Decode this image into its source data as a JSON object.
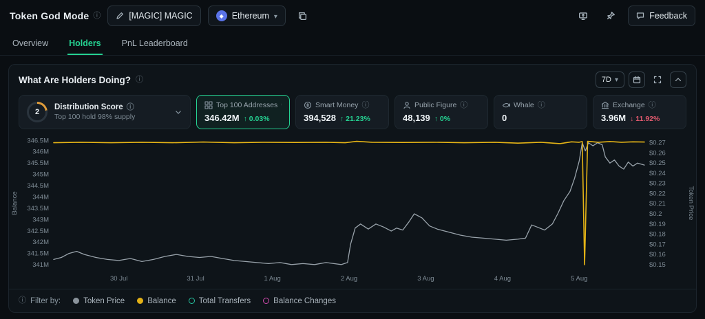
{
  "header": {
    "title": "Token God Mode",
    "token_pill": "[MAGIC] MAGIC",
    "chain": "Ethereum",
    "feedback_label": "Feedback",
    "action_icons": [
      "edit-icon",
      "ethereum-icon",
      "copy-icon",
      "share-icon",
      "pin-icon",
      "chat-icon"
    ]
  },
  "tabs": [
    {
      "label": "Overview",
      "active": false
    },
    {
      "label": "Holders",
      "active": true
    },
    {
      "label": "PnL Leaderboard",
      "active": false
    }
  ],
  "panel": {
    "title": "What Are Holders Doing?",
    "timeframe": "7D",
    "control_icons": [
      "calendar-icon",
      "expand-icon",
      "collapse-icon"
    ]
  },
  "stats": {
    "distribution": {
      "score": "2",
      "label": "Distribution Score",
      "subtitle": "Top 100 hold 98% supply"
    },
    "cards": [
      {
        "label": "Top 100 Addresses",
        "value": "346.42M",
        "change": "0.03%",
        "dir": "up",
        "selected": true,
        "icon": "grid-icon"
      },
      {
        "label": "Smart Money",
        "value": "394,528",
        "change": "21.23%",
        "dir": "up",
        "selected": false,
        "icon": "coin-icon"
      },
      {
        "label": "Public Figure",
        "value": "48,139",
        "change": "0%",
        "dir": "up",
        "selected": false,
        "icon": "person-icon"
      },
      {
        "label": "Whale",
        "value": "0",
        "change": "",
        "dir": "none",
        "selected": false,
        "icon": "whale-icon"
      },
      {
        "label": "Exchange",
        "value": "3.96M",
        "change": "11.92%",
        "dir": "down",
        "selected": false,
        "icon": "bank-icon"
      }
    ]
  },
  "footer": {
    "filter_label": "Filter by:",
    "legend": [
      {
        "label": "Token Price",
        "color": "#8a939b",
        "filled": true
      },
      {
        "label": "Balance",
        "color": "#e3b116",
        "filled": true
      },
      {
        "label": "Total Transfers",
        "color": "#27c4a0",
        "filled": false
      },
      {
        "label": "Balance Changes",
        "color": "#d44bb0",
        "filled": false
      }
    ]
  },
  "chart_data": {
    "type": "line",
    "x_ticks": [
      "30 Jul",
      "31 Jul",
      "1 Aug",
      "2 Aug",
      "3 Aug",
      "4 Aug",
      "5 Aug"
    ],
    "x_tick_positions": [
      1,
      2,
      3,
      4,
      5,
      6,
      7
    ],
    "x_range": [
      0.15,
      7.85
    ],
    "left_axis": {
      "label": "Balance",
      "ticks": [
        "346.5M",
        "346M",
        "345.5M",
        "345M",
        "344.5M",
        "344M",
        "343.5M",
        "343M",
        "342.5M",
        "342M",
        "341.5M",
        "341M"
      ],
      "tick_values": [
        346.5,
        346,
        345.5,
        345,
        344.5,
        344,
        343.5,
        343,
        342.5,
        342,
        341.5,
        341
      ],
      "range": [
        340.85,
        346.6
      ]
    },
    "right_axis": {
      "label": "Token Price",
      "ticks": [
        "$0.27",
        "$0.26",
        "$0.25",
        "$0.24",
        "$0.23",
        "$0.22",
        "$0.21",
        "$0.2",
        "$0.19",
        "$0.18",
        "$0.17",
        "$0.16",
        "$0.15"
      ],
      "tick_values": [
        0.27,
        0.26,
        0.25,
        0.24,
        0.23,
        0.22,
        0.21,
        0.2,
        0.19,
        0.18,
        0.17,
        0.16,
        0.15
      ],
      "range": [
        0.1465,
        0.2745
      ]
    },
    "series": [
      {
        "name": "Token Price",
        "axis": "right",
        "color": "#99a3ab",
        "width": 1.3,
        "points": [
          [
            0.15,
            0.155
          ],
          [
            0.25,
            0.157
          ],
          [
            0.35,
            0.161
          ],
          [
            0.45,
            0.163
          ],
          [
            0.55,
            0.16
          ],
          [
            0.7,
            0.157
          ],
          [
            0.85,
            0.155
          ],
          [
            1.0,
            0.154
          ],
          [
            1.15,
            0.156
          ],
          [
            1.3,
            0.153
          ],
          [
            1.45,
            0.155
          ],
          [
            1.6,
            0.158
          ],
          [
            1.75,
            0.16
          ],
          [
            1.9,
            0.158
          ],
          [
            2.05,
            0.157
          ],
          [
            2.2,
            0.158
          ],
          [
            2.35,
            0.156
          ],
          [
            2.5,
            0.154
          ],
          [
            2.65,
            0.153
          ],
          [
            2.8,
            0.152
          ],
          [
            2.95,
            0.151
          ],
          [
            3.1,
            0.152
          ],
          [
            3.25,
            0.15
          ],
          [
            3.4,
            0.151
          ],
          [
            3.55,
            0.15
          ],
          [
            3.7,
            0.152
          ],
          [
            3.8,
            0.151
          ],
          [
            3.9,
            0.15
          ],
          [
            3.98,
            0.152
          ],
          [
            4.02,
            0.17
          ],
          [
            4.08,
            0.186
          ],
          [
            4.15,
            0.19
          ],
          [
            4.25,
            0.185
          ],
          [
            4.35,
            0.19
          ],
          [
            4.45,
            0.187
          ],
          [
            4.55,
            0.183
          ],
          [
            4.62,
            0.186
          ],
          [
            4.7,
            0.184
          ],
          [
            4.78,
            0.192
          ],
          [
            4.85,
            0.2
          ],
          [
            4.95,
            0.196
          ],
          [
            5.05,
            0.188
          ],
          [
            5.15,
            0.185
          ],
          [
            5.3,
            0.182
          ],
          [
            5.45,
            0.179
          ],
          [
            5.6,
            0.177
          ],
          [
            5.75,
            0.176
          ],
          [
            5.9,
            0.175
          ],
          [
            6.05,
            0.174
          ],
          [
            6.2,
            0.175
          ],
          [
            6.3,
            0.176
          ],
          [
            6.38,
            0.189
          ],
          [
            6.45,
            0.187
          ],
          [
            6.55,
            0.184
          ],
          [
            6.65,
            0.19
          ],
          [
            6.72,
            0.2
          ],
          [
            6.8,
            0.213
          ],
          [
            6.88,
            0.222
          ],
          [
            6.94,
            0.235
          ],
          [
            7.0,
            0.252
          ],
          [
            7.04,
            0.27
          ],
          [
            7.08,
            0.262
          ],
          [
            7.12,
            0.27
          ],
          [
            7.18,
            0.267
          ],
          [
            7.24,
            0.27
          ],
          [
            7.3,
            0.268
          ],
          [
            7.34,
            0.256
          ],
          [
            7.4,
            0.25
          ],
          [
            7.46,
            0.253
          ],
          [
            7.52,
            0.247
          ],
          [
            7.58,
            0.244
          ],
          [
            7.64,
            0.251
          ],
          [
            7.7,
            0.247
          ],
          [
            7.76,
            0.25
          ],
          [
            7.85,
            0.248
          ]
        ]
      },
      {
        "name": "Balance",
        "axis": "left",
        "color": "#e5b416",
        "width": 1.6,
        "points": [
          [
            0.15,
            346.4
          ],
          [
            0.5,
            346.42
          ],
          [
            0.9,
            346.4
          ],
          [
            1.3,
            346.42
          ],
          [
            1.7,
            346.4
          ],
          [
            2.1,
            346.43
          ],
          [
            2.5,
            346.4
          ],
          [
            2.9,
            346.42
          ],
          [
            3.3,
            346.41
          ],
          [
            3.7,
            346.42
          ],
          [
            3.95,
            346.4
          ],
          [
            4.1,
            346.46
          ],
          [
            4.3,
            346.42
          ],
          [
            4.7,
            346.41
          ],
          [
            5.1,
            346.42
          ],
          [
            5.5,
            346.4
          ],
          [
            5.9,
            346.42
          ],
          [
            6.2,
            346.38
          ],
          [
            6.5,
            346.42
          ],
          [
            6.75,
            346.36
          ],
          [
            6.9,
            346.44
          ],
          [
            7.0,
            346.42
          ],
          [
            7.04,
            346.45
          ],
          [
            7.07,
            341.0
          ],
          [
            7.11,
            346.46
          ],
          [
            7.25,
            346.42
          ],
          [
            7.4,
            346.45
          ],
          [
            7.55,
            346.42
          ],
          [
            7.7,
            346.44
          ],
          [
            7.85,
            346.43
          ]
        ]
      }
    ]
  }
}
